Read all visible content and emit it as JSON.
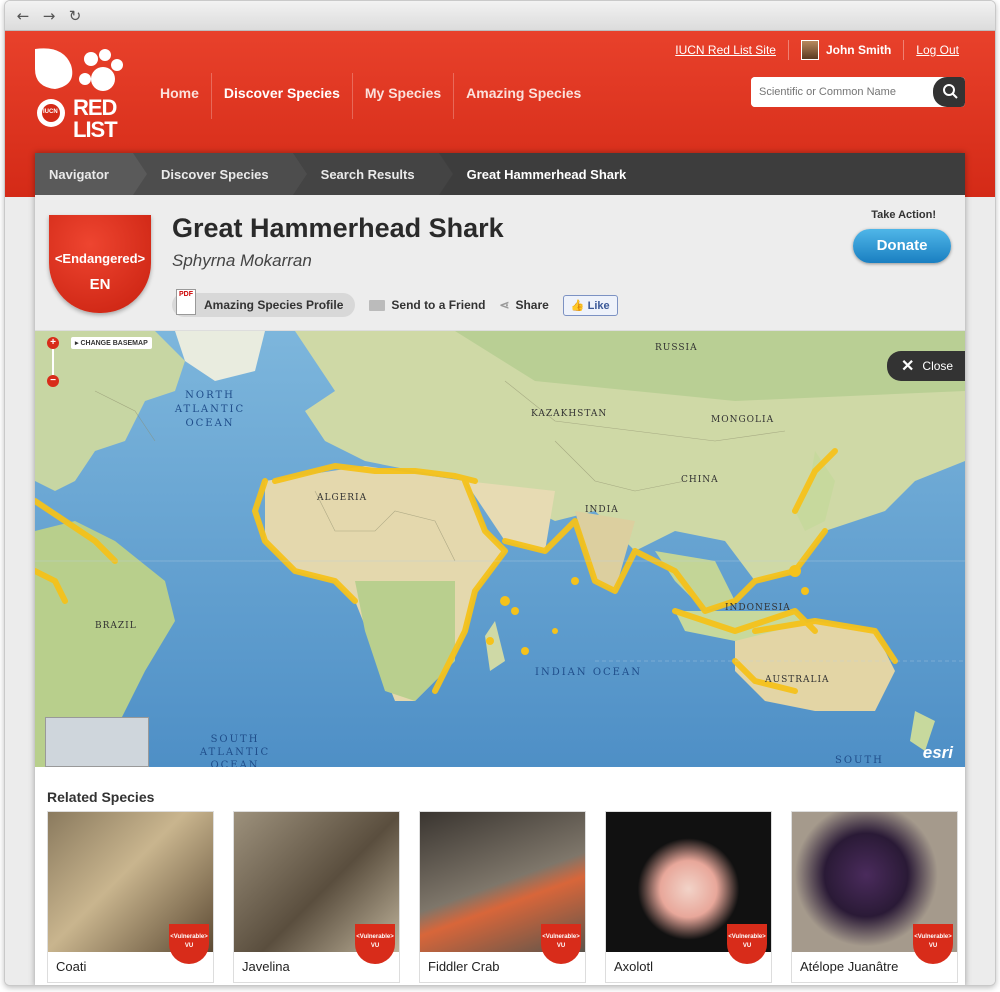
{
  "browser": {
    "back": "←",
    "forward": "→",
    "reload": "↻"
  },
  "header": {
    "logo_text_1": "RED",
    "logo_text_2": "LIST",
    "logo_badge": "IUCN",
    "nav": [
      {
        "label": "Home"
      },
      {
        "label": "Discover Species"
      },
      {
        "label": "My Species"
      },
      {
        "label": "Amazing Species"
      }
    ],
    "site_link": "IUCN Red List Site",
    "user_name": "John Smith",
    "logout": "Log Out",
    "search_placeholder": "Scientific or Common Name"
  },
  "breadcrumb": [
    "Navigator",
    "Discover Species",
    "Search Results",
    "Great Hammerhead Shark"
  ],
  "species": {
    "name": "Great Hammerhead Shark",
    "scientific": "Sphyrna Mokarran",
    "status": "<Endangered>",
    "status_code": "EN",
    "take_action": "Take Action!",
    "donate": "Donate",
    "profile_link": "Amazing Species Profile",
    "send": "Send to a Friend",
    "share": "Share",
    "like": "Like",
    "pdf_label": "PDF"
  },
  "map": {
    "change_basemap": "▸ CHANGE BASEMAP",
    "close": "Close",
    "zoom_in": "+",
    "zoom_out": "−",
    "attribution": "esri",
    "labels": {
      "north_atlantic": "NORTH ATLANTIC OCEAN",
      "south_atlantic": "SOUTH ATLANTIC OCEAN",
      "indian": "INDIAN OCEAN",
      "russia": "RUSSIA",
      "kazakhstan": "KAZAKHSTAN",
      "mongolia": "MONGOLIA",
      "china": "CHINA",
      "india": "INDIA",
      "algeria": "ALGERIA",
      "brazil": "BRAZIL",
      "australia": "AUSTRALIA",
      "indonesia": "INDONESIA",
      "south": "SOUTH"
    }
  },
  "related": {
    "title": "Related Species",
    "items": [
      {
        "name": "Coati",
        "status": "<Vulnerable>",
        "code": "VU"
      },
      {
        "name": "Javelina",
        "status": "<Vulnerable>",
        "code": "VU"
      },
      {
        "name": "Fiddler Crab",
        "status": "<Vulnerable>",
        "code": "VU"
      },
      {
        "name": "Axolotl",
        "status": "<Vulnerable>",
        "code": "VU"
      },
      {
        "name": "Atélope Juanâtre",
        "status": "<Vulnerable>",
        "code": "VU"
      }
    ]
  },
  "colors": {
    "brand_red": "#d42a17",
    "donate_blue": "#1a7fc1",
    "range_yellow": "#f5c21b"
  }
}
